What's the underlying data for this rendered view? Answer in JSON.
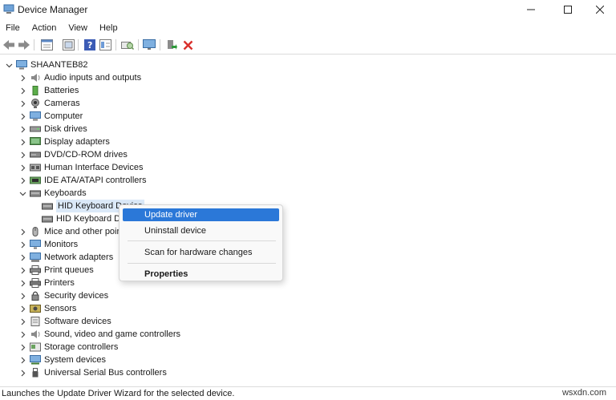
{
  "window": {
    "title": "Device Manager",
    "controls": {
      "minimize": "—",
      "maximize": "☐",
      "close": "✕"
    }
  },
  "menu": [
    "File",
    "Action",
    "View",
    "Help"
  ],
  "toolbar": {
    "buttons": [
      "back-icon",
      "forward-icon",
      "properties-icon",
      "show-hide-icon",
      "help-icon",
      "details-icon",
      "scan-icon",
      "monitor-icon",
      "update-driver-icon",
      "uninstall-icon"
    ]
  },
  "tree": {
    "root": "SHAANTEB82",
    "items": [
      {
        "label": "Audio inputs and outputs",
        "icon": "speaker-icon",
        "expanded": false
      },
      {
        "label": "Batteries",
        "icon": "battery-icon",
        "expanded": false
      },
      {
        "label": "Cameras",
        "icon": "camera-icon",
        "expanded": false
      },
      {
        "label": "Computer",
        "icon": "computer-icon",
        "expanded": false
      },
      {
        "label": "Disk drives",
        "icon": "disk-icon",
        "expanded": false
      },
      {
        "label": "Display adapters",
        "icon": "display-icon",
        "expanded": false
      },
      {
        "label": "DVD/CD-ROM drives",
        "icon": "dvd-icon",
        "expanded": false
      },
      {
        "label": "Human Interface Devices",
        "icon": "hid-icon",
        "expanded": false
      },
      {
        "label": "IDE ATA/ATAPI controllers",
        "icon": "ide-icon",
        "expanded": false
      },
      {
        "label": "Keyboards",
        "icon": "keyboard-icon",
        "expanded": true
      },
      {
        "label": "Mice and other poir",
        "icon": "mouse-icon",
        "expanded": false
      },
      {
        "label": "Monitors",
        "icon": "monitor-icon",
        "expanded": false
      },
      {
        "label": "Network adapters",
        "icon": "network-icon",
        "expanded": false
      },
      {
        "label": "Print queues",
        "icon": "printqueue-icon",
        "expanded": false
      },
      {
        "label": "Printers",
        "icon": "printer-icon",
        "expanded": false
      },
      {
        "label": "Security devices",
        "icon": "security-icon",
        "expanded": false
      },
      {
        "label": "Sensors",
        "icon": "sensor-icon",
        "expanded": false
      },
      {
        "label": "Software devices",
        "icon": "software-icon",
        "expanded": false
      },
      {
        "label": "Sound, video and game controllers",
        "icon": "sound-icon",
        "expanded": false
      },
      {
        "label": "Storage controllers",
        "icon": "storage-icon",
        "expanded": false
      },
      {
        "label": "System devices",
        "icon": "system-icon",
        "expanded": false
      },
      {
        "label": "Universal Serial Bus controllers",
        "icon": "usb-icon",
        "expanded": false
      }
    ],
    "keyboard_children": [
      "HID Keyboard Device",
      "HID Keyboard De"
    ]
  },
  "context_menu": {
    "items": [
      "Update driver",
      "Uninstall device",
      "Scan for hardware changes",
      "Properties"
    ],
    "highlighted": "Update driver"
  },
  "status": {
    "text": "Launches the Update Driver Wizard for the selected device.",
    "watermark": "wsxdn.com"
  },
  "colors": {
    "highlight": "#2b78d8",
    "selection": "#dbe9f8",
    "uninstall": "#d9302c",
    "help": "#3b5bb5"
  }
}
